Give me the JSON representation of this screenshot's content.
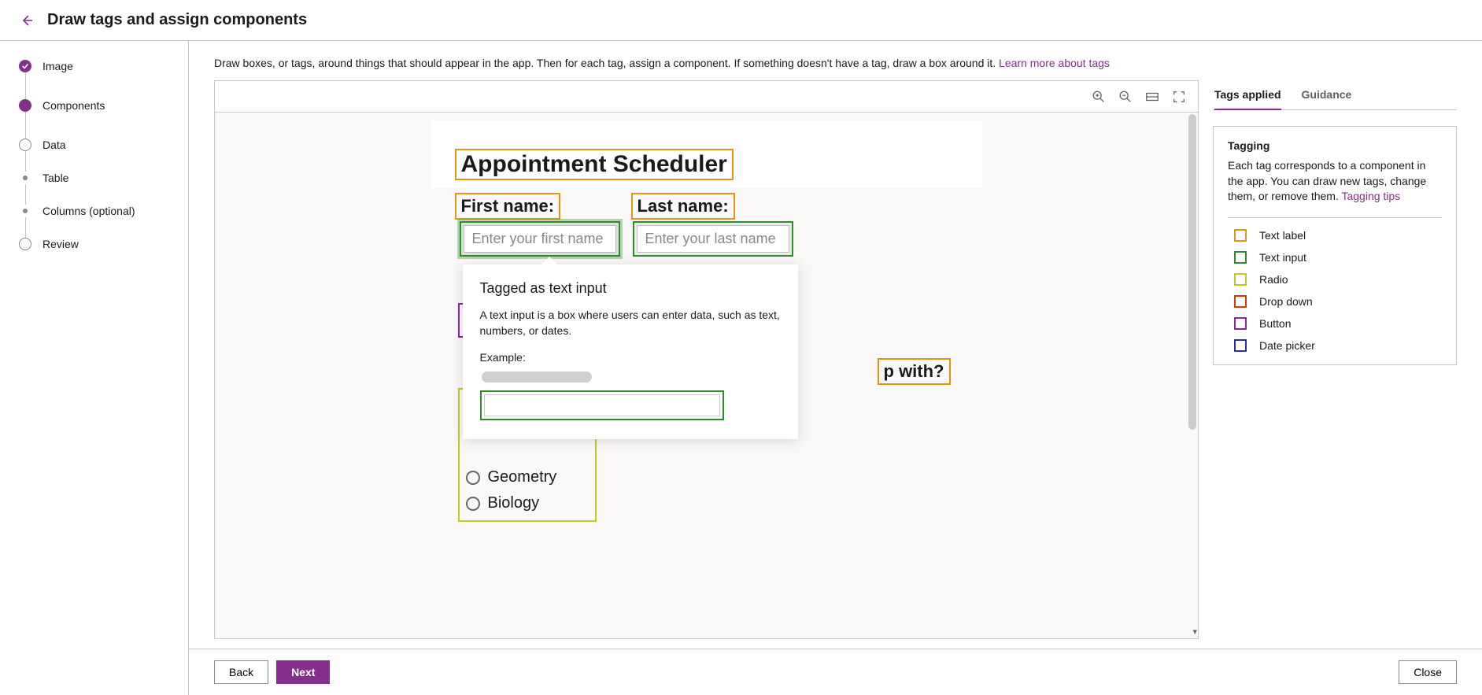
{
  "header": {
    "title": "Draw tags and assign components"
  },
  "steps": {
    "image": "Image",
    "components": "Components",
    "data": "Data",
    "table": "Table",
    "columns": "Columns (optional)",
    "review": "Review"
  },
  "instruction": {
    "text": "Draw boxes, or tags, around things that should appear in the app. Then for each tag, assign a component. If something doesn't have a tag, draw a box around it. ",
    "link": "Learn more about tags"
  },
  "preview": {
    "heading": "Appointment Scheduler",
    "first_name_label": "First name:",
    "last_name_label": "Last name:",
    "first_name_placeholder": "Enter your first name",
    "last_name_placeholder": "Enter your last name",
    "question_suffix": "p with?",
    "radio_options": [
      "Geometry",
      "Biology"
    ]
  },
  "callout": {
    "title": "Tagged as text input",
    "description": "A text input is a box where users can enter data, such as text, numbers, or dates.",
    "example_label": "Example:"
  },
  "side": {
    "tabs": {
      "applied": "Tags applied",
      "guidance": "Guidance"
    },
    "card_title": "Tagging",
    "card_body": "Each tag corresponds to a component in the app. You can draw new tags, change them, or remove them. ",
    "card_link": "Tagging tips",
    "legend": [
      {
        "label": "Text label",
        "color": "#e39412"
      },
      {
        "label": "Text input",
        "color": "#2e8b2e"
      },
      {
        "label": "Radio",
        "color": "#bfc92e"
      },
      {
        "label": "Drop down",
        "color": "#d83b01"
      },
      {
        "label": "Button",
        "color": "#8a24a1"
      },
      {
        "label": "Date picker",
        "color": "#2b2ea0"
      }
    ]
  },
  "footer": {
    "back": "Back",
    "next": "Next",
    "close": "Close"
  }
}
